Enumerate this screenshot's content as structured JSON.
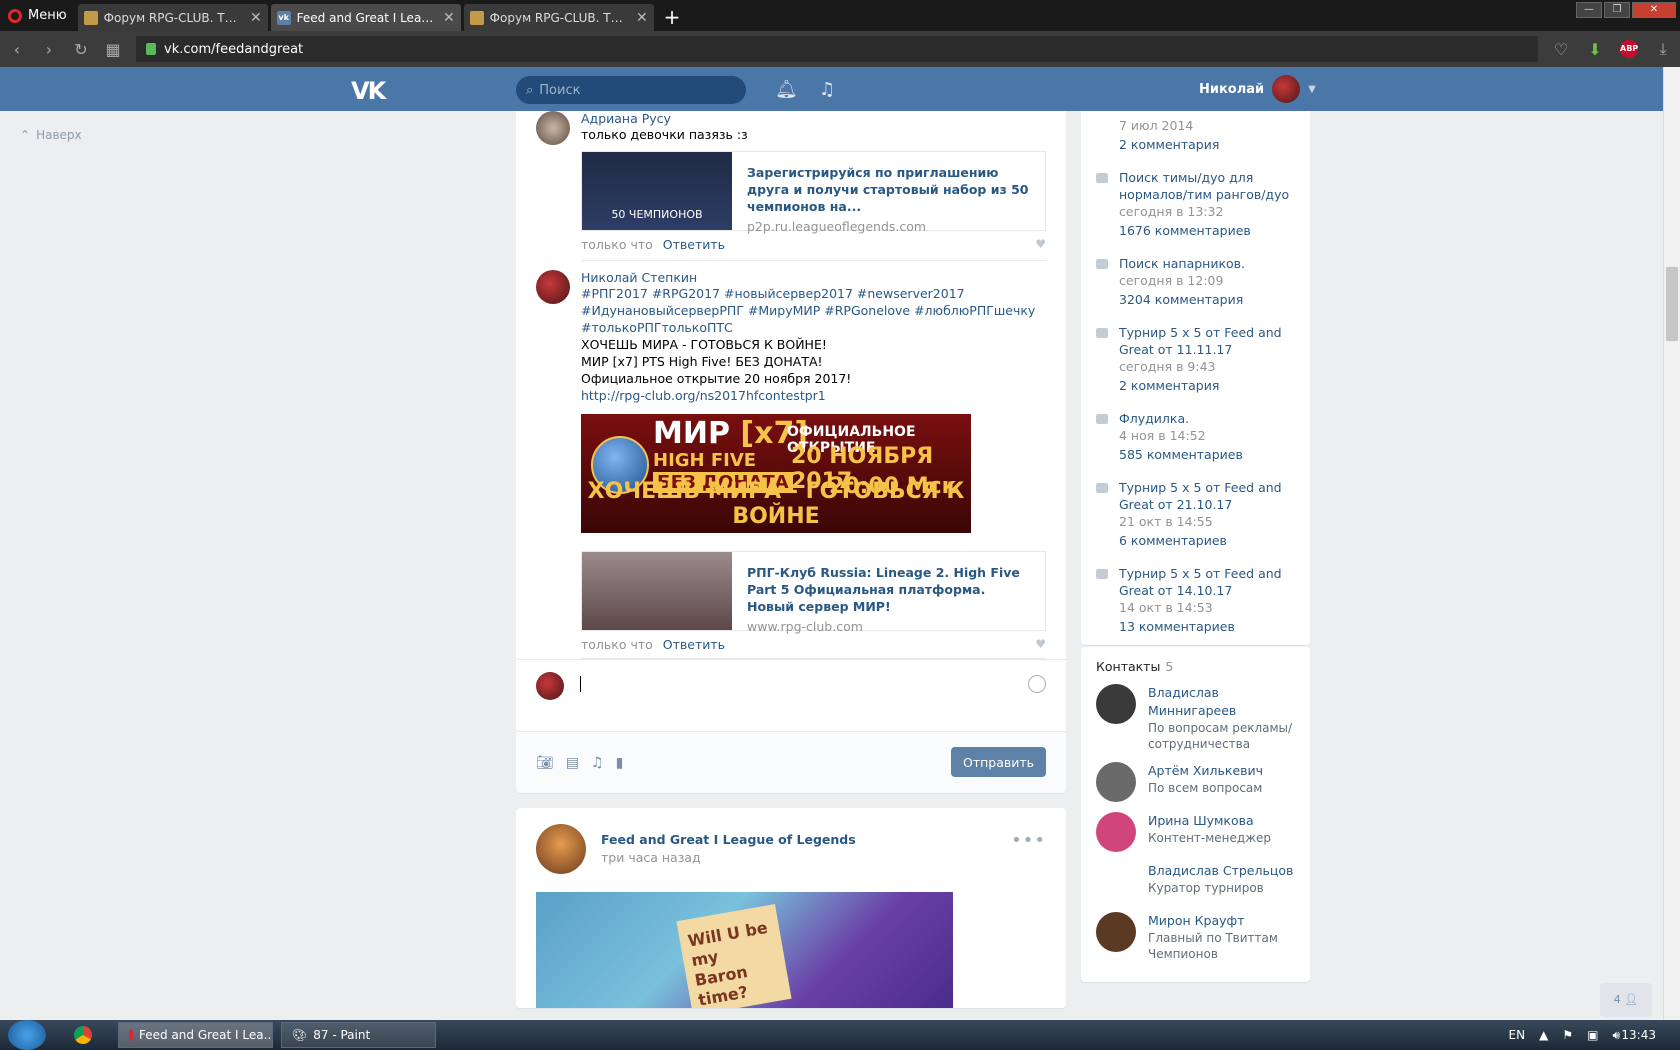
{
  "browser": {
    "menu_label": "Меню",
    "tabs": [
      {
        "title": "Форум RPG-CLUB. Тема: I"
      },
      {
        "title": "Feed and Great I League o"
      },
      {
        "title": "Форум RPG-CLUB. Тема: I"
      }
    ],
    "url": "vk.com/feedandgreat",
    "abp_label": "ABP"
  },
  "vk_header": {
    "logo": "VK",
    "search_placeholder": "Поиск",
    "user_name": "Николай"
  },
  "side_nav": {
    "up_label": "Наверх"
  },
  "comments": [
    {
      "author": "Адриана Русу",
      "text": "только девочки пазязь :з",
      "snippet": {
        "thumb_caption": "50 ЧЕМПИОНОВ",
        "title": "Зарегистрируйся по приглашению друга и получи стартовый набор из 50 чемпионов на...",
        "domain": "p2p.ru.leagueoflegends.com"
      },
      "time": "только что",
      "reply_label": "Ответить"
    },
    {
      "author": "Николай Степкин",
      "hashtags": "#РПГ2017 #RPG2017 #новыйсервер2017 #newserver2017 #ИдунановыйсерверРПГ #МируМИР #RPGonelove #люблюРПГшечку #толькоРПГтолькоПТС",
      "lines": [
        "ХОЧЕШЬ МИРА - ГОТОВЬСЯ К ВОЙНЕ!",
        "МИР [x7] PTS High Five! БЕЗ ДОНАТА!",
        "Официальное открытие 20 ноября 2017!"
      ],
      "link": "http://rpg-club.org/ns2017hfcontestpr1",
      "banner": {
        "mir": "МИР",
        "x7": "[x7]",
        "high_five": "HIGH FIVE",
        "no_donate": "БЕЗ ДОНАТА",
        "opening": "ОФИЦИАЛЬНОЕ ОТКРЫТИЕ",
        "date": "20 НОЯБРЯ 2017",
        "time": "20:00 Мск",
        "slogan": "ХОЧЕШЬ МИРА - ГОТОВЬСЯ К ВОЙНЕ"
      },
      "snippet": {
        "title": "РПГ-Клуб Russia: Lineage 2. High Five Part 5 Официальная платформа. Новый сервер МИР!",
        "domain": "www.rpg-club.com"
      },
      "time": "только что",
      "reply_label": "Ответить"
    }
  ],
  "reply_form": {
    "send_label": "Отправить"
  },
  "post": {
    "author": "Feed and Great I League of Legends",
    "time": "три часа назад",
    "image_text": "Will U be my Baron time?"
  },
  "topics": [
    {
      "title": "",
      "date": "7 июл 2014",
      "comments": "2 комментария"
    },
    {
      "title": "Поиск тимы/дуо для нормалов/тим рангов/дуо",
      "date": "сегодня в 13:32",
      "comments": "1676 комментариев"
    },
    {
      "title": "Поиск напарников.",
      "date": "сегодня в 12:09",
      "comments": "3204 комментария"
    },
    {
      "title": "Турнир 5 x 5 от Feed and Great от 11.11.17",
      "date": "сегодня в 9:43",
      "comments": "2 комментария"
    },
    {
      "title": "Флудилка.",
      "date": "4 ноя в 14:52",
      "comments": "585 комментариев"
    },
    {
      "title": "Турнир 5 x 5 от Feed and Great от 21.10.17",
      "date": "21 окт в 14:55",
      "comments": "6 комментариев"
    },
    {
      "title": "Турнир 5 x 5 от Feed and Great от 14.10.17",
      "date": "14 окт в 14:53",
      "comments": "13 комментариев"
    }
  ],
  "contacts": {
    "header": "Контакты",
    "count": "5",
    "items": [
      {
        "name": "Владислав Миннигареев",
        "role": "По вопросам рекламы/ сотрудничества",
        "color": "#3a3a3a"
      },
      {
        "name": "Артём Хилькевич",
        "role": "По всем вопросам",
        "color": "#6a6a6a"
      },
      {
        "name": "Ирина Шумкова",
        "role": "Контент-менеджер",
        "color": "#d0457a"
      },
      {
        "name": "Владислав Стрельцов",
        "role": "Куратор турниров",
        "color": "#ffffff"
      },
      {
        "name": "Мирон Крауфт",
        "role": "Главный по Твиттам Чемпионов",
        "color": "#5a3a22"
      }
    ]
  },
  "chat_count": "4",
  "taskbar": {
    "items": [
      {
        "label": "Feed and Great I Lea..."
      },
      {
        "label": "87 - Paint"
      }
    ],
    "lang": "EN",
    "clock": "13:43"
  }
}
